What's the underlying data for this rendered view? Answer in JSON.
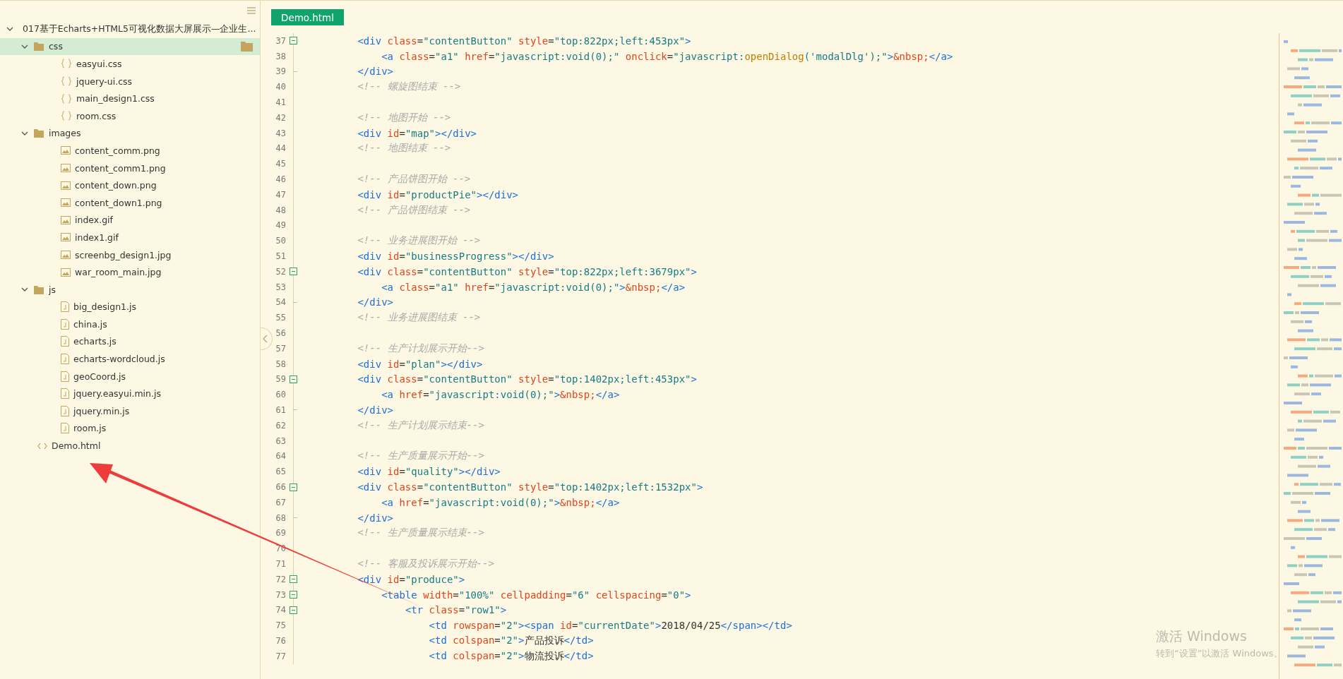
{
  "sidebar": {
    "tree": {
      "label": "017基于Echarts+HTML5可视化数据大屏展示—企业生...",
      "kind": "project",
      "expanded": true,
      "selected": false,
      "children": [
        {
          "label": "css",
          "kind": "folder",
          "expanded": true,
          "selected": true,
          "children": [
            {
              "label": "easyui.css",
              "kind": "css",
              "selected": false
            },
            {
              "label": "jquery-ui.css",
              "kind": "css",
              "selected": false
            },
            {
              "label": "main_design1.css",
              "kind": "css",
              "selected": false
            },
            {
              "label": "room.css",
              "kind": "css",
              "selected": false
            }
          ]
        },
        {
          "label": "images",
          "kind": "folder",
          "expanded": true,
          "selected": false,
          "children": [
            {
              "label": "content_comm.png",
              "kind": "image",
              "selected": false
            },
            {
              "label": "content_comm1.png",
              "kind": "image",
              "selected": false
            },
            {
              "label": "content_down.png",
              "kind": "image",
              "selected": false
            },
            {
              "label": "content_down1.png",
              "kind": "image",
              "selected": false
            },
            {
              "label": "index.gif",
              "kind": "image",
              "selected": false
            },
            {
              "label": "index1.gif",
              "kind": "image",
              "selected": false
            },
            {
              "label": "screenbg_design1.jpg",
              "kind": "image",
              "selected": false
            },
            {
              "label": "war_room_main.jpg",
              "kind": "image",
              "selected": false
            }
          ]
        },
        {
          "label": "js",
          "kind": "folder",
          "expanded": true,
          "selected": false,
          "children": [
            {
              "label": "big_design1.js",
              "kind": "js",
              "selected": false
            },
            {
              "label": "china.js",
              "kind": "js",
              "selected": false
            },
            {
              "label": "echarts.js",
              "kind": "js",
              "selected": false
            },
            {
              "label": "echarts-wordcloud.js",
              "kind": "js",
              "selected": false
            },
            {
              "label": "geoCoord.js",
              "kind": "js",
              "selected": false
            },
            {
              "label": "jquery.easyui.min.js",
              "kind": "js",
              "selected": false
            },
            {
              "label": "jquery.min.js",
              "kind": "js",
              "selected": false
            },
            {
              "label": "room.js",
              "kind": "js",
              "selected": false
            }
          ]
        },
        {
          "label": "Demo.html",
          "kind": "html",
          "selected": false
        }
      ]
    }
  },
  "editor": {
    "tabs": [
      {
        "label": "Demo.html",
        "selected": true
      }
    ],
    "lines": [
      {
        "number": "37",
        "kind": "fold_start",
        "tokens": [
          {
            "kind": "tag",
            "text": "<div"
          },
          {
            "kind": "attr",
            "text": " class"
          },
          {
            "kind": "plain",
            "text": "="
          },
          {
            "kind": "string",
            "text": "\"contentButton\""
          },
          {
            "kind": "attr",
            "text": " style"
          },
          {
            "kind": "plain",
            "text": "="
          },
          {
            "kind": "string",
            "text": "\"top:822px;left:453px\""
          },
          {
            "kind": "tag",
            "text": ">"
          }
        ]
      },
      {
        "number": "38",
        "kind": "line",
        "tokens": [
          {
            "kind": "tag",
            "text": "<a"
          },
          {
            "kind": "attr",
            "text": " class"
          },
          {
            "kind": "plain",
            "text": "="
          },
          {
            "kind": "string",
            "text": "\"a1\""
          },
          {
            "kind": "attr",
            "text": " href"
          },
          {
            "kind": "plain",
            "text": "="
          },
          {
            "kind": "string",
            "text": "\"javascript:void(0);\""
          },
          {
            "kind": "attr",
            "text": " onclick"
          },
          {
            "kind": "plain",
            "text": "="
          },
          {
            "kind": "string",
            "text": "\"javascript:"
          },
          {
            "kind": "function",
            "text": "openDialog"
          },
          {
            "kind": "string",
            "text": "('modalDlg');\""
          },
          {
            "kind": "tag",
            "text": ">"
          },
          {
            "kind": "entity",
            "text": "&nbsp;"
          },
          {
            "kind": "tag",
            "text": "</a>"
          }
        ]
      },
      {
        "number": "39",
        "kind": "fold_end",
        "tokens": [
          {
            "kind": "tag",
            "text": "</div>"
          }
        ]
      },
      {
        "number": "40",
        "kind": "line",
        "tokens": [
          {
            "kind": "comment",
            "text": "<!-- 螺旋图结束 -->"
          }
        ]
      },
      {
        "number": "41",
        "kind": "line"
      },
      {
        "number": "42",
        "kind": "line",
        "tokens": [
          {
            "kind": "comment",
            "text": "<!-- 地图开始 -->"
          }
        ]
      },
      {
        "number": "43",
        "kind": "line",
        "tokens": [
          {
            "kind": "tag",
            "text": "<div"
          },
          {
            "kind": "attr",
            "text": " id"
          },
          {
            "kind": "plain",
            "text": "="
          },
          {
            "kind": "string",
            "text": "\"map\""
          },
          {
            "kind": "tag",
            "text": "></div>"
          }
        ]
      },
      {
        "number": "44",
        "kind": "line",
        "tokens": [
          {
            "kind": "comment",
            "text": "<!-- 地图结束 -->"
          }
        ]
      },
      {
        "number": "45",
        "kind": "line"
      },
      {
        "number": "46",
        "kind": "line",
        "tokens": [
          {
            "kind": "comment",
            "text": "<!-- 产品饼图开始 -->"
          }
        ]
      },
      {
        "number": "47",
        "kind": "line",
        "tokens": [
          {
            "kind": "tag",
            "text": "<div"
          },
          {
            "kind": "attr",
            "text": " id"
          },
          {
            "kind": "plain",
            "text": "="
          },
          {
            "kind": "string",
            "text": "\"productPie\""
          },
          {
            "kind": "tag",
            "text": "></div>"
          }
        ]
      },
      {
        "number": "48",
        "kind": "line",
        "tokens": [
          {
            "kind": "comment",
            "text": "<!-- 产品饼图结束 -->"
          }
        ]
      },
      {
        "number": "49",
        "kind": "line"
      },
      {
        "number": "50",
        "kind": "line",
        "tokens": [
          {
            "kind": "comment",
            "text": "<!-- 业务进展图开始 -->"
          }
        ]
      },
      {
        "number": "51",
        "kind": "line",
        "tokens": [
          {
            "kind": "tag",
            "text": "<div"
          },
          {
            "kind": "attr",
            "text": " id"
          },
          {
            "kind": "plain",
            "text": "="
          },
          {
            "kind": "string",
            "text": "\"businessProgress\""
          },
          {
            "kind": "tag",
            "text": "></div>"
          }
        ]
      },
      {
        "number": "52",
        "kind": "fold_start",
        "tokens": [
          {
            "kind": "tag",
            "text": "<div"
          },
          {
            "kind": "attr",
            "text": " class"
          },
          {
            "kind": "plain",
            "text": "="
          },
          {
            "kind": "string",
            "text": "\"contentButton\""
          },
          {
            "kind": "attr",
            "text": " style"
          },
          {
            "kind": "plain",
            "text": "="
          },
          {
            "kind": "string",
            "text": "\"top:822px;left:3679px\""
          },
          {
            "kind": "tag",
            "text": ">"
          }
        ]
      },
      {
        "number": "53",
        "kind": "line",
        "tokens": [
          {
            "kind": "tag",
            "text": "<a"
          },
          {
            "kind": "attr",
            "text": " class"
          },
          {
            "kind": "plain",
            "text": "="
          },
          {
            "kind": "string",
            "text": "\"a1\""
          },
          {
            "kind": "attr",
            "text": " href"
          },
          {
            "kind": "plain",
            "text": "="
          },
          {
            "kind": "string",
            "text": "\"javascript:void(0);\""
          },
          {
            "kind": "tag",
            "text": ">"
          },
          {
            "kind": "entity",
            "text": "&nbsp;"
          },
          {
            "kind": "tag",
            "text": "</a>"
          }
        ]
      },
      {
        "number": "54",
        "kind": "fold_end",
        "tokens": [
          {
            "kind": "tag",
            "text": "</div>"
          }
        ]
      },
      {
        "number": "55",
        "kind": "line",
        "tokens": [
          {
            "kind": "comment",
            "text": "<!-- 业务进展图结束 -->"
          }
        ]
      },
      {
        "number": "56",
        "kind": "line"
      },
      {
        "number": "57",
        "kind": "line",
        "tokens": [
          {
            "kind": "comment",
            "text": "<!-- 生产计划展示开始-->"
          }
        ]
      },
      {
        "number": "58",
        "kind": "line",
        "tokens": [
          {
            "kind": "tag",
            "text": "<div"
          },
          {
            "kind": "attr",
            "text": " id"
          },
          {
            "kind": "plain",
            "text": "="
          },
          {
            "kind": "string",
            "text": "\"plan\""
          },
          {
            "kind": "tag",
            "text": "></div>"
          }
        ]
      },
      {
        "number": "59",
        "kind": "fold_start",
        "tokens": [
          {
            "kind": "tag",
            "text": "<div"
          },
          {
            "kind": "attr",
            "text": " class"
          },
          {
            "kind": "plain",
            "text": "="
          },
          {
            "kind": "string",
            "text": "\"contentButton\""
          },
          {
            "kind": "attr",
            "text": " style"
          },
          {
            "kind": "plain",
            "text": "="
          },
          {
            "kind": "string",
            "text": "\"top:1402px;left:453px\""
          },
          {
            "kind": "tag",
            "text": ">"
          }
        ]
      },
      {
        "number": "60",
        "kind": "line",
        "tokens": [
          {
            "kind": "tag",
            "text": "<a"
          },
          {
            "kind": "attr",
            "text": " href"
          },
          {
            "kind": "plain",
            "text": "="
          },
          {
            "kind": "string",
            "text": "\"javascript:void(0);\""
          },
          {
            "kind": "tag",
            "text": ">"
          },
          {
            "kind": "entity",
            "text": "&nbsp;"
          },
          {
            "kind": "tag",
            "text": "</a>"
          }
        ]
      },
      {
        "number": "61",
        "kind": "fold_end",
        "tokens": [
          {
            "kind": "tag",
            "text": "</div>"
          }
        ]
      },
      {
        "number": "62",
        "kind": "line",
        "tokens": [
          {
            "kind": "comment",
            "text": "<!-- 生产计划展示结束-->"
          }
        ]
      },
      {
        "number": "63",
        "kind": "line"
      },
      {
        "number": "64",
        "kind": "line",
        "tokens": [
          {
            "kind": "comment",
            "text": "<!-- 生产质量展示开始-->"
          }
        ]
      },
      {
        "number": "65",
        "kind": "line",
        "tokens": [
          {
            "kind": "tag",
            "text": "<div"
          },
          {
            "kind": "attr",
            "text": " id"
          },
          {
            "kind": "plain",
            "text": "="
          },
          {
            "kind": "string",
            "text": "\"quality\""
          },
          {
            "kind": "tag",
            "text": "></div>"
          }
        ]
      },
      {
        "number": "66",
        "kind": "fold_start",
        "tokens": [
          {
            "kind": "tag",
            "text": "<div"
          },
          {
            "kind": "attr",
            "text": " class"
          },
          {
            "kind": "plain",
            "text": "="
          },
          {
            "kind": "string",
            "text": "\"contentButton\""
          },
          {
            "kind": "attr",
            "text": " style"
          },
          {
            "kind": "plain",
            "text": "="
          },
          {
            "kind": "string",
            "text": "\"top:1402px;left:1532px\""
          },
          {
            "kind": "tag",
            "text": ">"
          }
        ]
      },
      {
        "number": "67",
        "kind": "line",
        "tokens": [
          {
            "kind": "tag",
            "text": "<a"
          },
          {
            "kind": "attr",
            "text": " href"
          },
          {
            "kind": "plain",
            "text": "="
          },
          {
            "kind": "string",
            "text": "\"javascript:void(0);\""
          },
          {
            "kind": "tag",
            "text": ">"
          },
          {
            "kind": "entity",
            "text": "&nbsp;"
          },
          {
            "kind": "tag",
            "text": "</a>"
          }
        ]
      },
      {
        "number": "68",
        "kind": "fold_end",
        "tokens": [
          {
            "kind": "tag",
            "text": "</div>"
          }
        ]
      },
      {
        "number": "69",
        "kind": "line",
        "tokens": [
          {
            "kind": "comment",
            "text": "<!-- 生产质量展示结束-->"
          }
        ]
      },
      {
        "number": "70",
        "kind": "line"
      },
      {
        "number": "71",
        "kind": "line",
        "tokens": [
          {
            "kind": "comment",
            "text": "<!-- 客服及投诉展示开始-->"
          }
        ]
      },
      {
        "number": "72",
        "kind": "fold_start",
        "tokens": [
          {
            "kind": "tag",
            "text": "<div"
          },
          {
            "kind": "attr",
            "text": " id"
          },
          {
            "kind": "plain",
            "text": "="
          },
          {
            "kind": "string",
            "text": "\"produce\""
          },
          {
            "kind": "tag",
            "text": ">"
          }
        ]
      },
      {
        "number": "73",
        "kind": "fold_start",
        "tokens": [
          {
            "kind": "tag",
            "text": "<table"
          },
          {
            "kind": "attr",
            "text": " width"
          },
          {
            "kind": "plain",
            "text": "="
          },
          {
            "kind": "string",
            "text": "\"100%\""
          },
          {
            "kind": "attr",
            "text": " cellpadding"
          },
          {
            "kind": "plain",
            "text": "="
          },
          {
            "kind": "string",
            "text": "\"6\""
          },
          {
            "kind": "attr",
            "text": " cellspacing"
          },
          {
            "kind": "plain",
            "text": "="
          },
          {
            "kind": "string",
            "text": "\"0\""
          },
          {
            "kind": "tag",
            "text": ">"
          }
        ]
      },
      {
        "number": "74",
        "kind": "fold_start",
        "tokens": [
          {
            "kind": "tag",
            "text": "<tr"
          },
          {
            "kind": "attr",
            "text": " class"
          },
          {
            "kind": "plain",
            "text": "="
          },
          {
            "kind": "string",
            "text": "\"row1\""
          },
          {
            "kind": "tag",
            "text": ">"
          }
        ]
      },
      {
        "number": "75",
        "kind": "line",
        "tokens": [
          {
            "kind": "tag",
            "text": "<td"
          },
          {
            "kind": "attr",
            "text": " rowspan"
          },
          {
            "kind": "plain",
            "text": "="
          },
          {
            "kind": "string",
            "text": "\"2\""
          },
          {
            "kind": "tag",
            "text": "><span"
          },
          {
            "kind": "attr",
            "text": " id"
          },
          {
            "kind": "plain",
            "text": "="
          },
          {
            "kind": "string",
            "text": "\"currentDate\""
          },
          {
            "kind": "tag",
            "text": ">"
          },
          {
            "kind": "plain",
            "text": "2018/04/25"
          },
          {
            "kind": "tag",
            "text": "</span></td>"
          }
        ]
      },
      {
        "number": "76",
        "kind": "line",
        "tokens": [
          {
            "kind": "tag",
            "text": "<td"
          },
          {
            "kind": "attr",
            "text": " colspan"
          },
          {
            "kind": "plain",
            "text": "="
          },
          {
            "kind": "string",
            "text": "\"2\""
          },
          {
            "kind": "tag",
            "text": ">"
          },
          {
            "kind": "plain",
            "text": "产品投诉"
          },
          {
            "kind": "tag",
            "text": "</td>"
          }
        ]
      },
      {
        "number": "77",
        "kind": "line",
        "tokens": [
          {
            "kind": "tag",
            "text": "<td"
          },
          {
            "kind": "attr",
            "text": " colspan"
          },
          {
            "kind": "plain",
            "text": "="
          },
          {
            "kind": "string",
            "text": "\"2\""
          },
          {
            "kind": "tag",
            "text": ">"
          },
          {
            "kind": "plain",
            "text": "物流投诉"
          },
          {
            "kind": "tag",
            "text": "</td>"
          }
        ]
      }
    ]
  },
  "activation_notice": {
    "title": "激活 Windows",
    "message": "转到“设置”以激活 Windows。"
  }
}
